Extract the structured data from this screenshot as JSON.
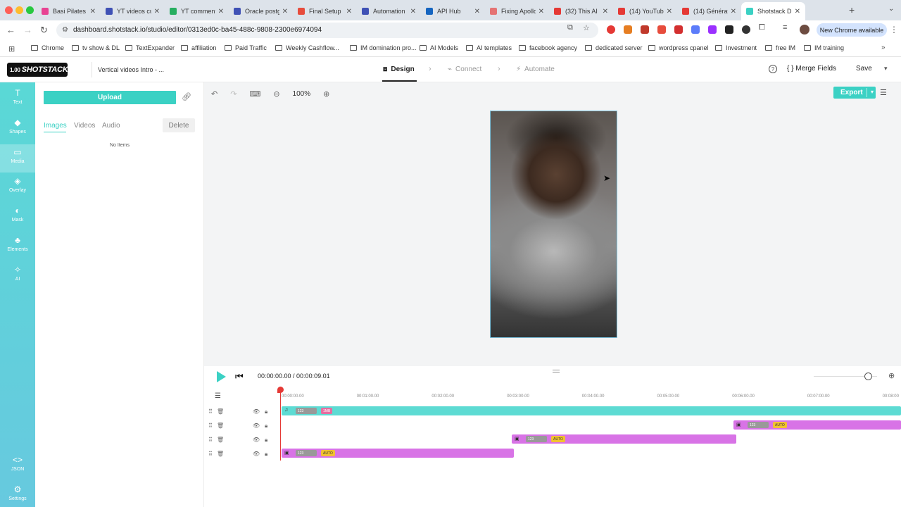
{
  "browser": {
    "tabs": [
      {
        "label": "Basi Pilates",
        "color": "#e84393"
      },
      {
        "label": "YT videos cur",
        "color": "#3f51b5"
      },
      {
        "label": "YT comments",
        "color": "#27ae60"
      },
      {
        "label": "Oracle postg",
        "color": "#3f51b5"
      },
      {
        "label": "Final Setup",
        "color": "#e74c3c"
      },
      {
        "label": "Automation",
        "color": "#3f51b5"
      },
      {
        "label": "API Hub",
        "color": "#1565c0"
      },
      {
        "label": "Fixing Apollo",
        "color": "#e57373"
      },
      {
        "label": "(32) This AI",
        "color": "#e53935"
      },
      {
        "label": "(14) YouTube",
        "color": "#e53935"
      },
      {
        "label": "(14) Génération",
        "color": "#e53935"
      },
      {
        "label": "Shotstack D",
        "color": "#3bd1c4"
      }
    ],
    "new_tab": "+",
    "url": "dashboard.shotstack.io/studio/editor/0313ed0c-ba45-488c-9808-2300e6974094",
    "new_chrome": "New Chrome available",
    "bookmarks": [
      "Chrome",
      "tv show & DL",
      "TextExpander",
      "affiliation",
      "Paid Traffic",
      "Weekly Cashflow...",
      "IM domination pro...",
      "AI Models",
      "AI templates",
      "facebook agency",
      "dedicated server",
      "wordpress cpanel",
      "Investment",
      "free IM",
      "IM training"
    ]
  },
  "app": {
    "logo_version": "1.00",
    "logo_text": "SHOTSTACK",
    "project_title": "Vertical videos Intro - ...",
    "steps": {
      "design": "Design",
      "connect": "Connect",
      "automate": "Automate"
    },
    "merge_fields": "{ } Merge Fields",
    "save": "Save"
  },
  "rail": [
    {
      "icon": "T",
      "label": "Text"
    },
    {
      "icon": "◆",
      "label": "Shapes"
    },
    {
      "icon": "▭",
      "label": "Media"
    },
    {
      "icon": "◈",
      "label": "Overlay"
    },
    {
      "icon": "◐",
      "label": "Mask"
    },
    {
      "icon": "♣",
      "label": "Elements"
    },
    {
      "icon": "✧",
      "label": "AI"
    },
    {
      "icon": "<>",
      "label": "JSON"
    },
    {
      "icon": "⚙",
      "label": "Settings"
    }
  ],
  "panel": {
    "upload": "Upload",
    "tabs": [
      "Images",
      "Videos",
      "Audio"
    ],
    "delete": "Delete",
    "empty": "No Items"
  },
  "canvas": {
    "zoom": "100%",
    "export": "Export"
  },
  "timeline": {
    "timecode": "00:00:00.00 / 00:00:09.01",
    "ticks": [
      "00:00:00.00",
      "00:01:00.00",
      "00:02:00.00",
      "00:03:00.00",
      "00:04:00.00",
      "00:05:00.00",
      "00:06:00.00",
      "00:07:00.00",
      "00:08:00"
    ],
    "badge_text": "123",
    "audio_badge": "1MB",
    "auto_label": "AUTO",
    "colors": {
      "audio": "#5ddbd3",
      "video": "#d873e6",
      "playhead": "#e53935",
      "accent": "#3bd1c4"
    }
  }
}
